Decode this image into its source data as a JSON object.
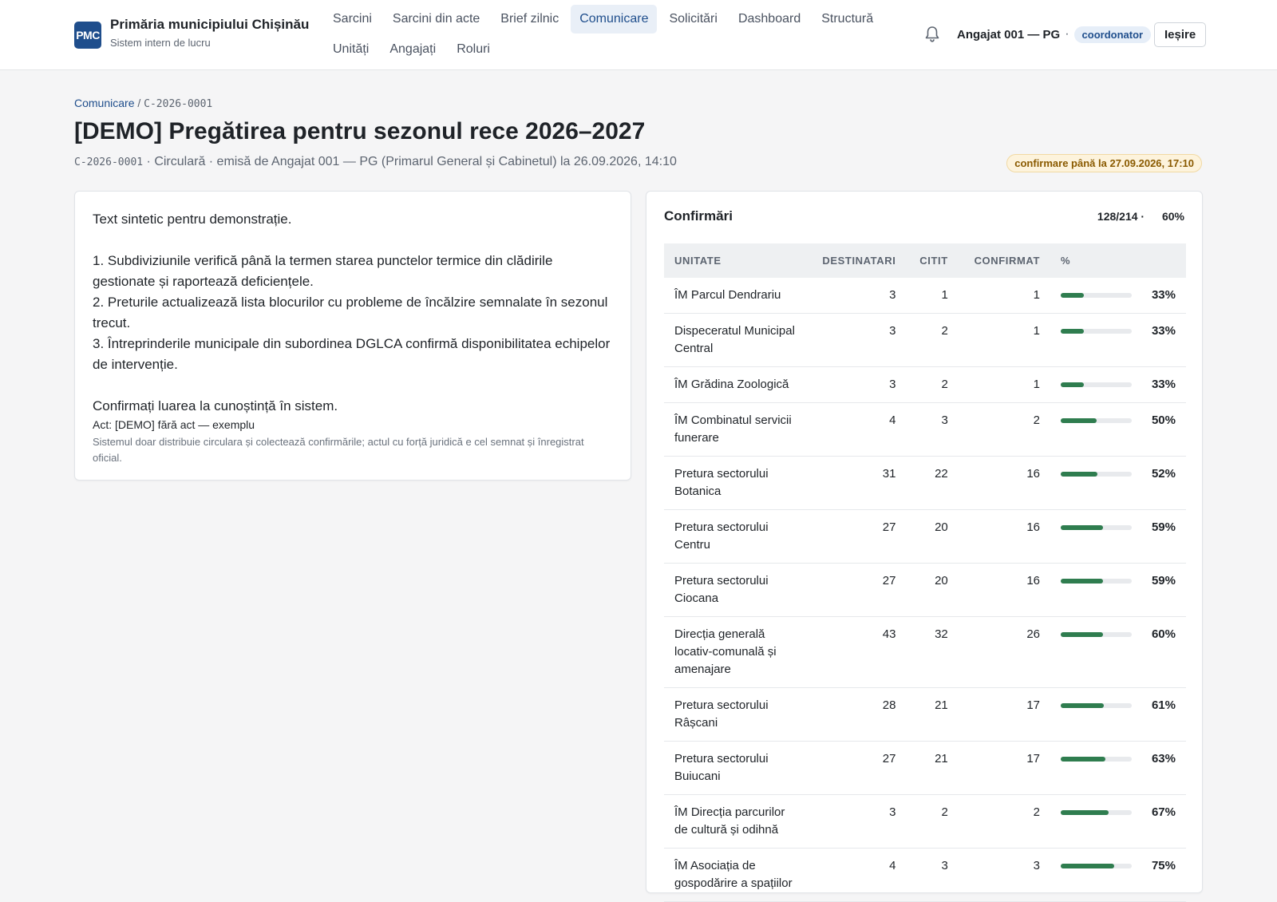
{
  "header": {
    "logo_text": "PMC",
    "title": "Primăria municipiului Chișinău",
    "subtitle": "Sistem intern de lucru",
    "nav": [
      {
        "label": "Sarcini",
        "active": false
      },
      {
        "label": "Sarcini din acte",
        "active": false
      },
      {
        "label": "Brief zilnic",
        "active": false
      },
      {
        "label": "Comunicare",
        "active": true
      },
      {
        "label": "Solicitări",
        "active": false
      },
      {
        "label": "Dashboard",
        "active": false
      },
      {
        "label": "Structură",
        "active": false
      },
      {
        "label": "Unități",
        "active": false
      },
      {
        "label": "Angajați",
        "active": false
      },
      {
        "label": "Roluri",
        "active": false
      }
    ],
    "notification_icon": "bell-icon",
    "user_name": "Angajat 001 — PG",
    "separator": "·",
    "role": "coordonator",
    "logout_label": "Ieșire"
  },
  "breadcrumb": {
    "section": "Comunicare",
    "separator": "/",
    "code": "C-2026-0001"
  },
  "page": {
    "title": "[DEMO] Pregătirea pentru sezonul rece 2026–2027",
    "meta_code": "C-2026-0001",
    "meta_text": "· Circulară · emisă de Angajat 001 — PG (Primarul General și Cabinetul) la 26.09.2026, 14:10",
    "deadline": "confirmare până la 27.09.2026, 17:10"
  },
  "circular": {
    "intro": "Text sintetic pentru demonstrație.",
    "items": [
      "1. Subdiviziunile verifică până la termen starea punctelor termice din clădirile gestionate și raportează deficiențele.",
      "2. Preturile actualizează lista blocurilor cu probleme de încălzire semnalate în sezonul trecut.",
      "3. Întreprinderile municipale din subordinea DGLCA confirmă disponibilitatea echipelor de intervenție."
    ],
    "closing": "Confirmați luarea la cunoștință în sistem.",
    "act": "Act: [DEMO] fără act — exemplu",
    "disclaimer": "Sistemul doar distribuie circulara și colectează confirmările; actul cu forță juridică e cel semnat și înregistrat oficial."
  },
  "confirmations": {
    "title": "Confirmări",
    "summary_count": "128/214 ·",
    "summary_pct": "60%",
    "columns": [
      "Unitate",
      "Destinatari",
      "Citit",
      "Confirmat",
      "%"
    ],
    "bar_color": "#2f7d4f",
    "rows": [
      {
        "unit": "ÎM Parcul Dendrariu",
        "recipients": "3",
        "read": "1",
        "confirmed": "1",
        "pct": "33%",
        "pct_value": 33
      },
      {
        "unit": "Dispeceratul Municipal Central",
        "recipients": "3",
        "read": "2",
        "confirmed": "1",
        "pct": "33%",
        "pct_value": 33
      },
      {
        "unit": "ÎM Grădina Zoologică",
        "recipients": "3",
        "read": "2",
        "confirmed": "1",
        "pct": "33%",
        "pct_value": 33
      },
      {
        "unit": "ÎM Combinatul servicii funerare",
        "recipients": "4",
        "read": "3",
        "confirmed": "2",
        "pct": "50%",
        "pct_value": 50
      },
      {
        "unit": "Pretura sectorului Botanica",
        "recipients": "31",
        "read": "22",
        "confirmed": "16",
        "pct": "52%",
        "pct_value": 52
      },
      {
        "unit": "Pretura sectorului Centru",
        "recipients": "27",
        "read": "20",
        "confirmed": "16",
        "pct": "59%",
        "pct_value": 59
      },
      {
        "unit": "Pretura sectorului Ciocana",
        "recipients": "27",
        "read": "20",
        "confirmed": "16",
        "pct": "59%",
        "pct_value": 59
      },
      {
        "unit": "Direcția generală locativ-comunală și amenajare",
        "recipients": "43",
        "read": "32",
        "confirmed": "26",
        "pct": "60%",
        "pct_value": 60
      },
      {
        "unit": "Pretura sectorului Râșcani",
        "recipients": "28",
        "read": "21",
        "confirmed": "17",
        "pct": "61%",
        "pct_value": 61
      },
      {
        "unit": "Pretura sectorului Buiucani",
        "recipients": "27",
        "read": "21",
        "confirmed": "17",
        "pct": "63%",
        "pct_value": 63
      },
      {
        "unit": "ÎM Direcția parcurilor de cultură și odihnă",
        "recipients": "3",
        "read": "2",
        "confirmed": "2",
        "pct": "67%",
        "pct_value": 67
      },
      {
        "unit": "ÎM Asociația de gospodărire a spațiilor",
        "recipients": "4",
        "read": "3",
        "confirmed": "3",
        "pct": "75%",
        "pct_value": 75
      }
    ]
  }
}
